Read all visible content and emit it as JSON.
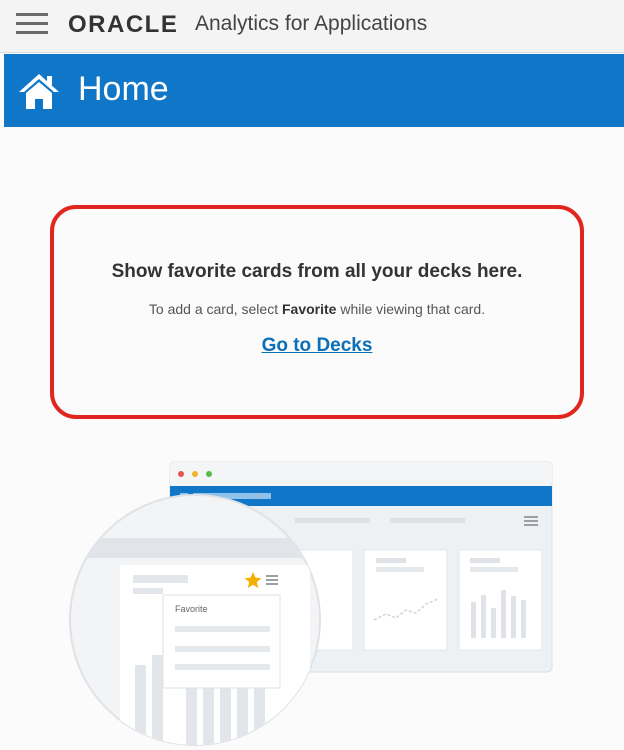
{
  "header": {
    "brand": "ORACLE",
    "app_name": "Analytics for Applications"
  },
  "page": {
    "title": "Home",
    "icon": "home-icon"
  },
  "empty_state": {
    "title": "Show favorite cards from all your decks here.",
    "desc_prefix": "To add a card, select ",
    "desc_bold": "Favorite",
    "desc_suffix": " while viewing that card.",
    "link": "Go to Decks"
  },
  "illustration": {
    "card_label": "Favorite"
  },
  "colors": {
    "accent": "#0f76c8",
    "highlight_border": "#e0261f",
    "link": "#0b6fb8",
    "star": "#f2b100"
  }
}
